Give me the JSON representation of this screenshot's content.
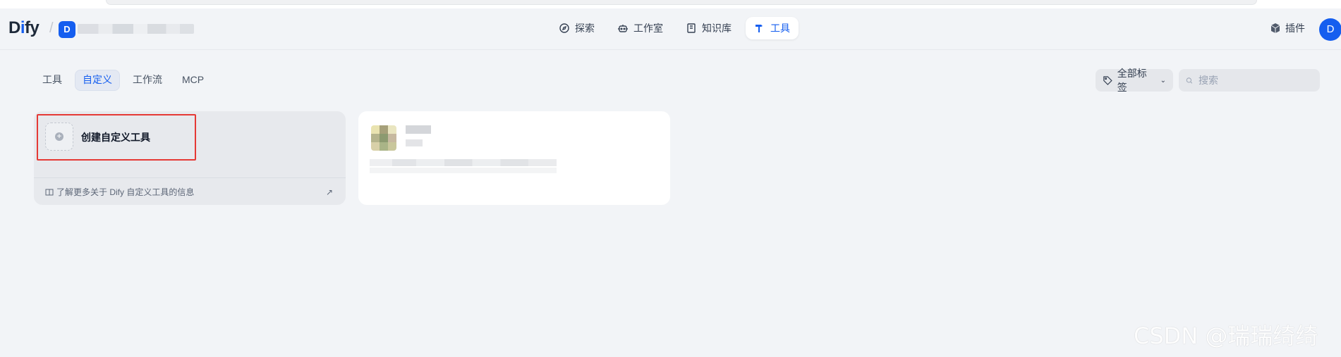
{
  "app": {
    "logo_prefix": "D",
    "logo_accent": "i",
    "logo_suffix": "fy",
    "workspace_initial": "D"
  },
  "nav": [
    {
      "label": "探索",
      "icon": "compass-icon"
    },
    {
      "label": "工作室",
      "icon": "robot-icon"
    },
    {
      "label": "知识库",
      "icon": "book-icon"
    },
    {
      "label": "工具",
      "icon": "hammer-icon",
      "active": true
    }
  ],
  "header": {
    "plugins_label": "插件",
    "user_initial": "D"
  },
  "tabs": [
    {
      "label": "工具"
    },
    {
      "label": "自定义",
      "active": true
    },
    {
      "label": "工作流"
    },
    {
      "label": "MCP"
    }
  ],
  "filters": {
    "tag_label": "全部标签",
    "search_placeholder": "搜索"
  },
  "create_card": {
    "title": "创建自定义工具",
    "learn_more": "了解更多关于 Dify 自定义工具的信息",
    "external_icon": "↗"
  },
  "watermark": "CSDN @瑞瑞绮绮",
  "colors": {
    "accent": "#155eef",
    "highlight": "#e53935",
    "background": "#f2f4f7"
  }
}
